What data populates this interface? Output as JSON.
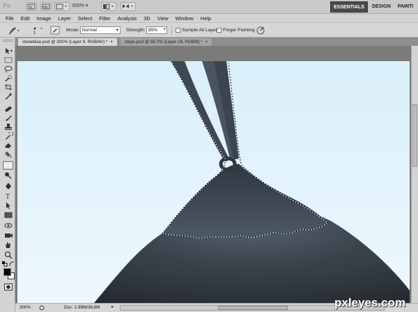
{
  "app": {
    "logo": "Ps",
    "zoom": "300%"
  },
  "workspace": [
    "ESSENTIALS",
    "DESIGN",
    "PAINTI"
  ],
  "menus": [
    "File",
    "Edit",
    "Image",
    "Layer",
    "Select",
    "Filter",
    "Analysis",
    "3D",
    "View",
    "Window",
    "Help"
  ],
  "options": {
    "brush_size": "1",
    "mode_label": "Mode:",
    "mode_value": "Normal",
    "strength_label": "Strength:",
    "strength_value": "85%",
    "sample_all_layers": "Sample All Layers",
    "finger_painting": "Finger Painting"
  },
  "tabs": [
    {
      "label": "stoneface.psd @ 300% (Layer 9, RGB/8#) *",
      "close": "×"
    },
    {
      "label": "steps.psd @ 66.7% (Layer 16, RGB/8) *",
      "close": "×"
    }
  ],
  "status": {
    "zoom": "300%",
    "doc": "Doc: 1.99M/36,6M"
  },
  "watermark": "pxleyes.com",
  "icons": {
    "tools": [
      "move-icon",
      "marquee-icon",
      "lasso-icon",
      "quick-select-icon",
      "crop-icon",
      "eyedropper-icon",
      "healing-icon",
      "brush-icon",
      "clone-stamp-icon",
      "history-brush-icon",
      "eraser-icon",
      "gradient-icon",
      "smudge-icon",
      "dodge-icon",
      "pen-icon",
      "type-icon",
      "path-select-icon",
      "shape-icon",
      "3d-rotate-icon",
      "3d-camera-icon",
      "hand-icon",
      "zoom-icon"
    ]
  },
  "colors": {
    "sky_top": "#dff2fb",
    "sky_bottom": "#e8f6fc",
    "rock_dark": "#2b3137",
    "rock_mid": "#454e57"
  }
}
